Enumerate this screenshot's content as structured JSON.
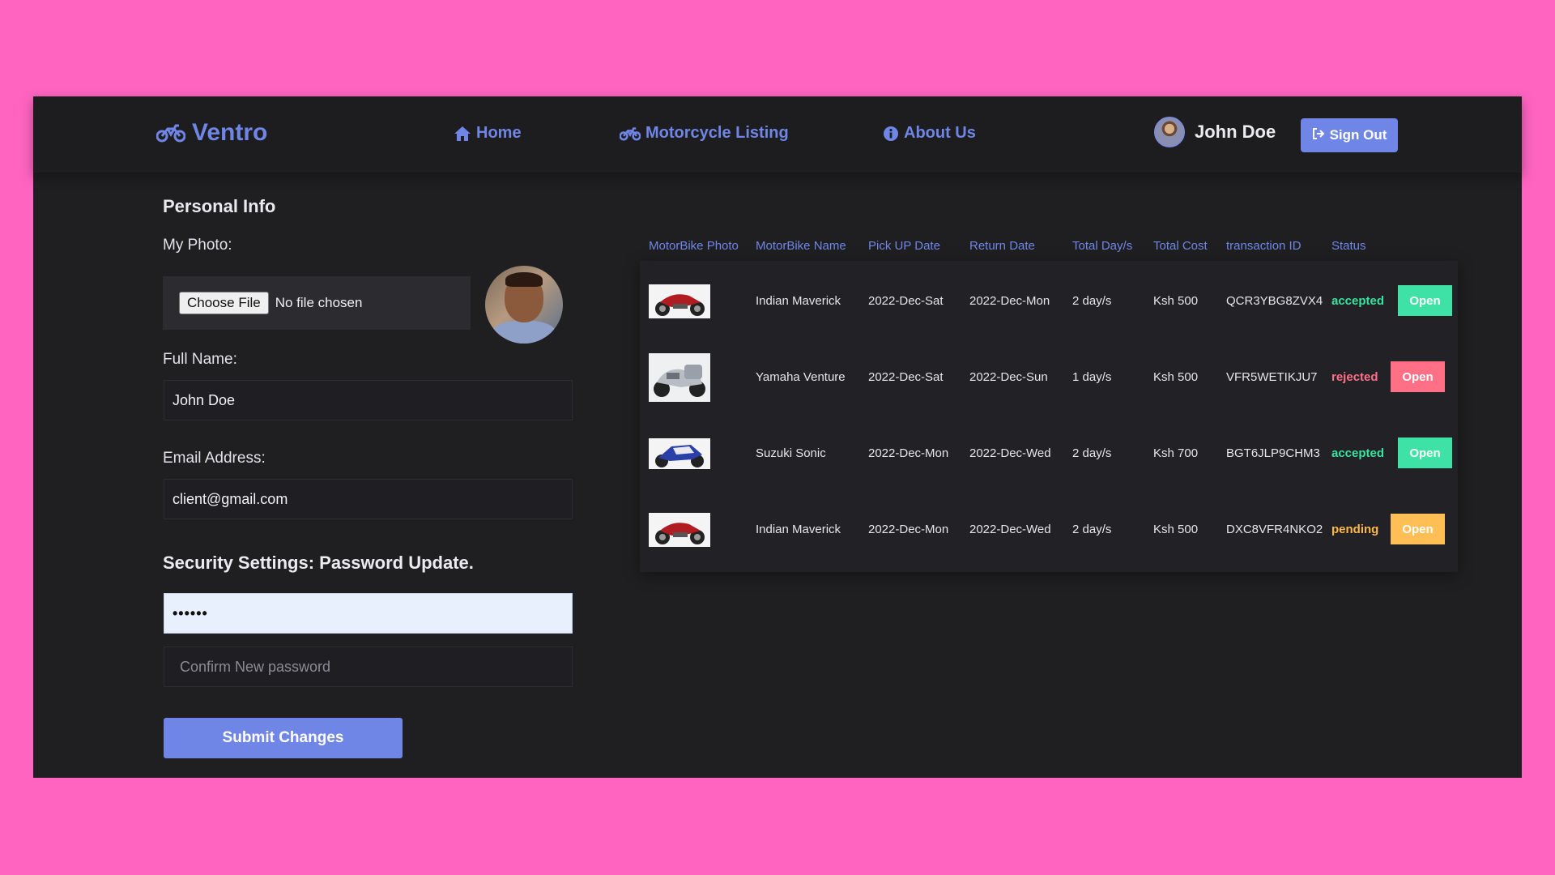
{
  "nav": {
    "brand": "Ventro",
    "links": [
      {
        "label": "Home",
        "icon": "home-icon"
      },
      {
        "label": "Motorcycle Listing",
        "icon": "motorcycle-icon"
      },
      {
        "label": "About Us",
        "icon": "info-icon"
      }
    ],
    "user_name": "John Doe",
    "signout_label": "Sign Out"
  },
  "profile": {
    "heading": "Personal Info",
    "photo_label": "My Photo:",
    "file_button": "Choose File",
    "file_status": "No file chosen",
    "full_name_label": "Full Name:",
    "full_name_value": "John Doe",
    "email_label": "Email Address:",
    "email_value": "client@gmail.com",
    "security_heading": "Security Settings: Password Update.",
    "password_value": "••••••",
    "confirm_placeholder": "Confirm New password",
    "submit_label": "Submit Changes"
  },
  "table": {
    "headers": [
      "MotorBike Photo",
      "MotorBike Name",
      "Pick UP Date",
      "Return Date",
      "Total Day/s",
      "Total Cost",
      "transaction ID",
      "Status"
    ],
    "open_label": "Open",
    "rows": [
      {
        "name": "Indian Maverick",
        "pickup": "2022-Dec-Sat",
        "return": "2022-Dec-Mon",
        "days": "2 day/s",
        "cost": "Ksh 500",
        "txn": "QCR3YBG8ZVX4",
        "status": "accepted",
        "status_color": "#38e3a0",
        "btn_color": "#3fe2a6",
        "bike": "red-cruiser"
      },
      {
        "name": "Yamaha Venture",
        "pickup": "2022-Dec-Sat",
        "return": "2022-Dec-Sun",
        "days": "1 day/s",
        "cost": "Ksh 500",
        "txn": "VFR5WETIKJU7",
        "status": "rejected",
        "status_color": "#ff6f86",
        "btn_color": "#ff6f86",
        "bike": "silver-tourer"
      },
      {
        "name": "Suzuki Sonic",
        "pickup": "2022-Dec-Mon",
        "return": "2022-Dec-Wed",
        "days": "2 day/s",
        "cost": "Ksh 700",
        "txn": "BGT6JLP9CHM3",
        "status": "accepted",
        "status_color": "#38e3a0",
        "btn_color": "#3fe2a6",
        "bike": "blue-sport"
      },
      {
        "name": "Indian Maverick",
        "pickup": "2022-Dec-Mon",
        "return": "2022-Dec-Wed",
        "days": "2 day/s",
        "cost": "Ksh 500",
        "txn": "DXC8VFR4NKO2",
        "status": "pending",
        "status_color": "#ffb84a",
        "btn_color": "#ffbf55",
        "bike": "red-cruiser"
      }
    ]
  }
}
